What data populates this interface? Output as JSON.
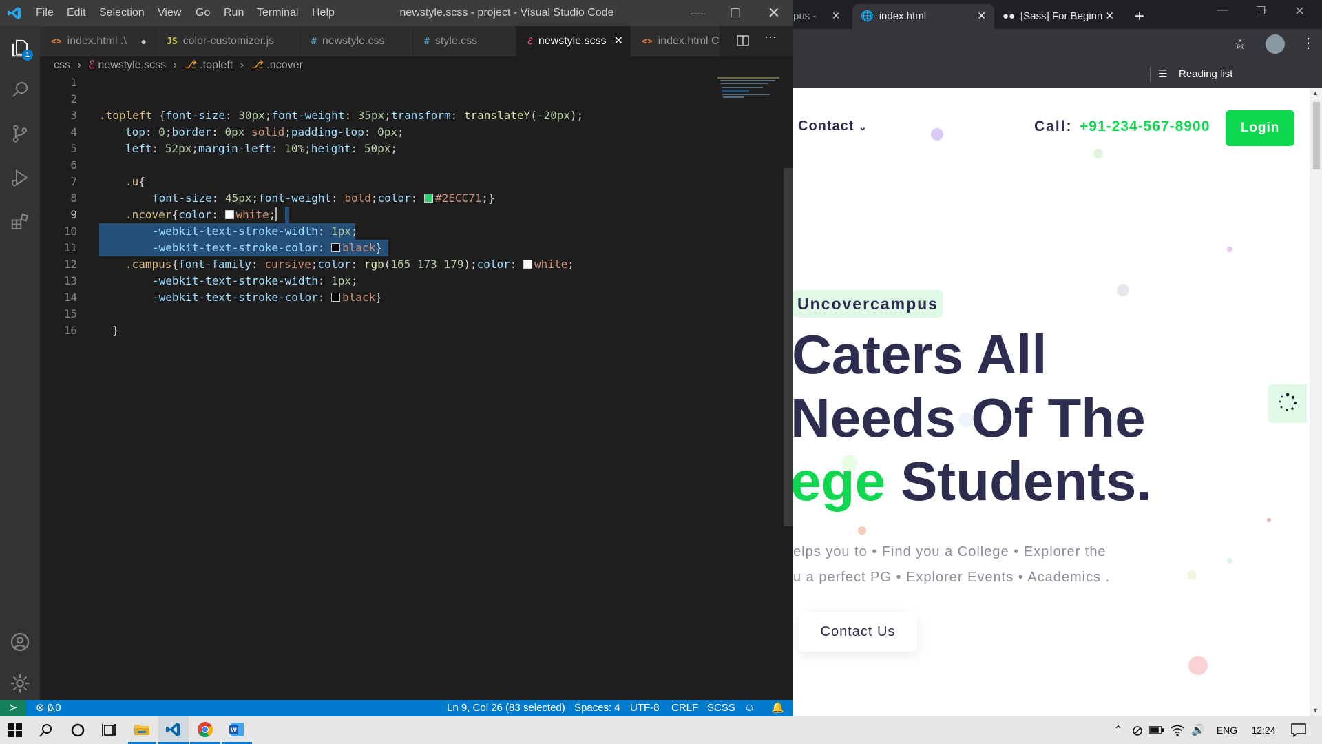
{
  "vscode": {
    "menu": [
      "File",
      "Edit",
      "Selection",
      "View",
      "Go",
      "Run",
      "Terminal",
      "Help"
    ],
    "title": "newstyle.scss - project - Visual Studio Code",
    "explorer_badge": "1",
    "tabs": [
      {
        "icon": "<>",
        "label": "index.html .\\",
        "icon_color": "#e37933",
        "modified": true
      },
      {
        "icon": "JS",
        "label": "color-customizer.js",
        "icon_color": "#cbcb41"
      },
      {
        "icon": "#",
        "label": "newstyle.css",
        "icon_color": "#519aba"
      },
      {
        "icon": "#",
        "label": "style.css",
        "icon_color": "#519aba"
      },
      {
        "icon": "ℰ",
        "label": "newstyle.scss",
        "icon_color": "#f55385",
        "active": true
      },
      {
        "icon": "<>",
        "label": "index.html C:\\",
        "icon_color": "#e37933"
      }
    ],
    "breadcrumb": [
      "css",
      "newstyle.scss",
      ".topleft",
      ".ncover"
    ],
    "line_numbers": [
      "1",
      "2",
      "3",
      "4",
      "5",
      "6",
      "7",
      "8",
      "9",
      "10",
      "11",
      "12",
      "13",
      "14",
      "15",
      "16"
    ],
    "code": {
      "l3": [
        ".topleft ",
        "{",
        "font-size",
        ": ",
        "30px",
        ";",
        "font-weight",
        ": ",
        "35px",
        ";",
        "transform",
        ": ",
        "translateY",
        "(",
        "-20px",
        ");"
      ],
      "l4": [
        "top",
        ": ",
        "0",
        ";",
        "border",
        ": ",
        "0px",
        " solid",
        ";",
        "padding-top",
        ": ",
        "0px",
        ";"
      ],
      "l5": [
        "left",
        ": ",
        "52px",
        ";",
        "margin-left",
        ": ",
        "10%",
        ";",
        "height",
        ": ",
        "50px",
        ";"
      ],
      "l7": [
        ".u",
        "{"
      ],
      "l8": [
        "font-size",
        ": ",
        "45px",
        ";",
        "font-weight",
        ": ",
        "bold",
        ";",
        "color",
        ": ",
        "#2ECC71",
        ";}"
      ],
      "l9": [
        ".ncover",
        "{",
        "color",
        ": ",
        "white",
        ";"
      ],
      "l10": [
        "-webkit-text-stroke-width",
        ": ",
        "1px",
        ";"
      ],
      "l11": [
        "-webkit-text-stroke-color",
        ": ",
        "black",
        "}"
      ],
      "l12": [
        ".campus",
        "{",
        "font-family",
        ": ",
        "cursive",
        ";",
        "color",
        ": ",
        "rgb",
        "(",
        "165 173 179",
        ");",
        "color",
        ": ",
        "white",
        ";"
      ],
      "l13": [
        "-webkit-text-stroke-width",
        ": ",
        "1px",
        ";"
      ],
      "l14": [
        "-webkit-text-stroke-color",
        ": ",
        "black",
        "}"
      ],
      "l16": [
        "}"
      ]
    },
    "status": {
      "errors": "0",
      "warnings": "0",
      "position": "Ln 9, Col 26 (83 selected)",
      "spaces": "Spaces: 4",
      "encoding": "UTF-8",
      "eol": "CRLF",
      "language": "SCSS"
    },
    "colors": {
      "accent": "#007acc",
      "selection": "#264f78",
      "green_swatch": "#2ECC71"
    }
  },
  "chrome": {
    "tabs": [
      "pus - ",
      "index.html",
      "[Sass] For Beginne"
    ],
    "reading_list": "Reading list"
  },
  "site": {
    "nav_contact": "Contact",
    "call_label": "Call:",
    "phone": "+91-234-567-8900",
    "login": "Login",
    "badge": "Uncovercampus",
    "headline1": "aters All",
    "headline1_first": "C",
    "headline2": "Needs Of The",
    "headline3_green": "ege",
    "headline3_rest": " Students.",
    "sub1": "elps you to • Find you a College • Explorer the",
    "sub2": "u a perfect PG • Explorer Events • Academics .",
    "contact_btn": "Contact Us",
    "colors": {
      "green": "#0fd850",
      "navy": "#2d2d4f"
    }
  },
  "taskbar": {
    "lang": "ENG",
    "time": "12:24"
  }
}
